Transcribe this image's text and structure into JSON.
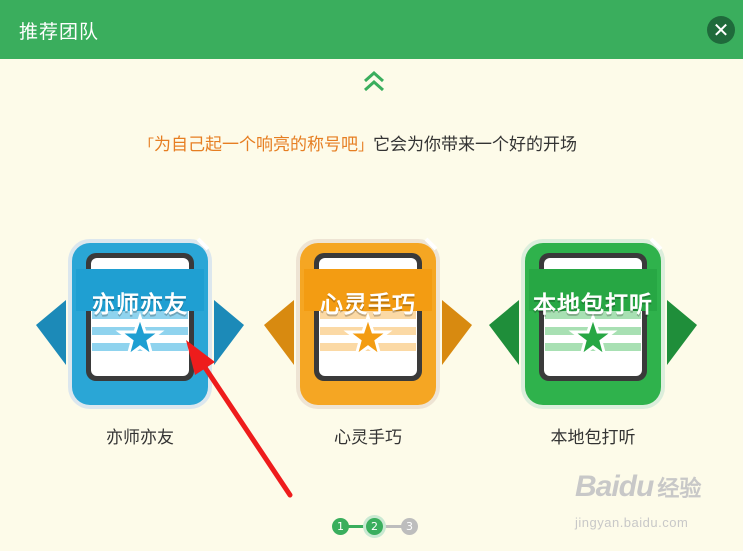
{
  "header": {
    "title": "推荐团队",
    "close_icon": "close-icon"
  },
  "tagline": {
    "bracket_open": "「",
    "highlight": "为自己起一个响亮的称号吧",
    "bracket_close": "」",
    "text": "它会为你带来一个好的开场"
  },
  "badges": [
    {
      "banner": "亦师亦友",
      "caption": "亦师亦友",
      "color": "#2aa6d6"
    },
    {
      "banner": "心灵手巧",
      "caption": "心灵手巧",
      "color": "#f5a623"
    },
    {
      "banner": "本地包打听",
      "caption": "本地包打听",
      "color": "#2fb24c"
    }
  ],
  "stepper": {
    "steps": [
      "1",
      "2",
      "3"
    ],
    "current": 2,
    "active_color": "#3aae5d",
    "inactive_color": "#bdbdbd"
  },
  "watermark": {
    "brand": "Baidu",
    "cn": "经验",
    "url": "jingyan.baidu.com"
  }
}
